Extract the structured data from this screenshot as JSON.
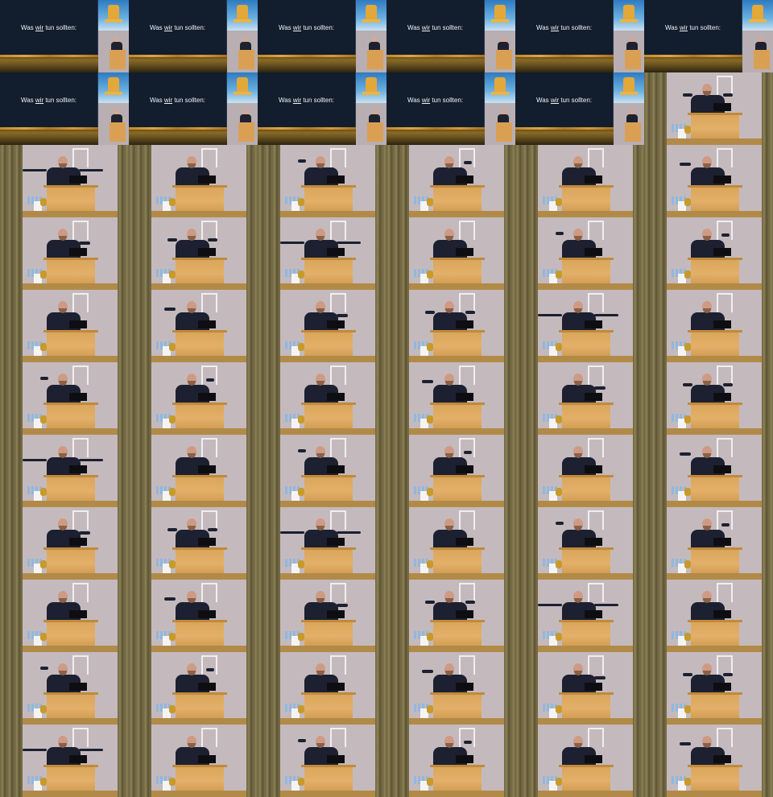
{
  "image": {
    "description_free": true,
    "slide_text_prefix": "Was ",
    "slide_text_emph": "wir",
    "slide_text_suffix": " tun sollten:",
    "tiles": [
      "slide",
      "slide",
      "slide",
      "slide",
      "slide",
      "slide",
      "slide",
      "slide",
      "slide",
      "slide",
      "slide",
      "speaker",
      "speaker",
      "speaker",
      "speaker",
      "speaker",
      "speaker",
      "speaker",
      "speaker",
      "speaker",
      "speaker",
      "speaker",
      "speaker",
      "speaker",
      "speaker",
      "speaker",
      "speaker",
      "speaker",
      "speaker",
      "speaker",
      "speaker",
      "speaker",
      "speaker",
      "speaker",
      "speaker",
      "speaker",
      "speaker",
      "speaker",
      "speaker",
      "speaker",
      "speaker",
      "speaker",
      "speaker",
      "speaker",
      "speaker",
      "speaker",
      "speaker",
      "speaker",
      "speaker",
      "speaker",
      "speaker",
      "speaker",
      "speaker",
      "speaker",
      "speaker",
      "speaker",
      "speaker",
      "speaker",
      "speaker",
      "speaker",
      "speaker",
      "speaker",
      "speaker",
      "speaker",
      "speaker",
      "speaker"
    ],
    "colors": {
      "slide_bg": "#121d2e",
      "field": "#8a6a26",
      "logo_sky": "#2f7bc0",
      "logo_tower": "#e3a83a",
      "wall": "#c4babd",
      "curtain": "#7a7048",
      "lectern": "#d9a458",
      "shirt": "#1c2030"
    }
  }
}
